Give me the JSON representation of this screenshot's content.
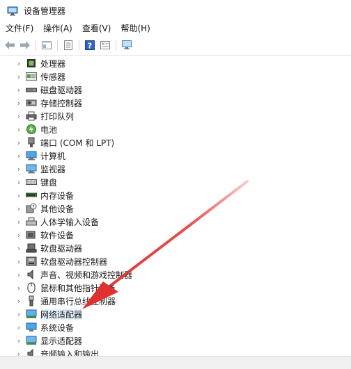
{
  "window": {
    "title": "设备管理器",
    "icon": "device-manager-icon"
  },
  "menu": {
    "items": [
      "文件(F)",
      "操作(A)",
      "查看(V)",
      "帮助(H)"
    ]
  },
  "toolbar": {
    "icons": [
      "back-arrow-icon",
      "forward-arrow-icon",
      "properties-icon",
      "list-view-icon",
      "help-icon",
      "details-icon",
      "monitor-icon"
    ]
  },
  "tree": {
    "selected": "网络适配器",
    "items": [
      {
        "label": "处理器",
        "icon": "processor-icon"
      },
      {
        "label": "传感器",
        "icon": "sensor-icon"
      },
      {
        "label": "磁盘驱动器",
        "icon": "disk-drive-icon"
      },
      {
        "label": "存储控制器",
        "icon": "storage-controller-icon"
      },
      {
        "label": "打印队列",
        "icon": "printer-icon"
      },
      {
        "label": "电池",
        "icon": "battery-icon"
      },
      {
        "label": "端口 (COM 和 LPT)",
        "icon": "port-icon"
      },
      {
        "label": "计算机",
        "icon": "computer-icon"
      },
      {
        "label": "监视器",
        "icon": "monitor-icon"
      },
      {
        "label": "键盘",
        "icon": "keyboard-icon"
      },
      {
        "label": "内存设备",
        "icon": "memory-icon"
      },
      {
        "label": "其他设备",
        "icon": "other-device-icon"
      },
      {
        "label": "人体学输入设备",
        "icon": "hid-icon"
      },
      {
        "label": "软件设备",
        "icon": "software-device-icon"
      },
      {
        "label": "软盘驱动器",
        "icon": "floppy-drive-icon"
      },
      {
        "label": "软盘驱动器控制器",
        "icon": "floppy-controller-icon"
      },
      {
        "label": "声音、视频和游戏控制器",
        "icon": "speaker-icon"
      },
      {
        "label": "鼠标和其他指针设备",
        "icon": "mouse-icon"
      },
      {
        "label": "通用串行总线控制器",
        "icon": "usb-icon"
      },
      {
        "label": "网络适配器",
        "icon": "network-adapter-icon"
      },
      {
        "label": "系统设备",
        "icon": "system-device-icon"
      },
      {
        "label": "显示适配器",
        "icon": "display-adapter-icon"
      },
      {
        "label": "音频输入和输出",
        "icon": "audio-io-icon"
      }
    ]
  },
  "annotation": {
    "arrow_color": "#e03131",
    "icon": "red-arrow-annotation"
  }
}
